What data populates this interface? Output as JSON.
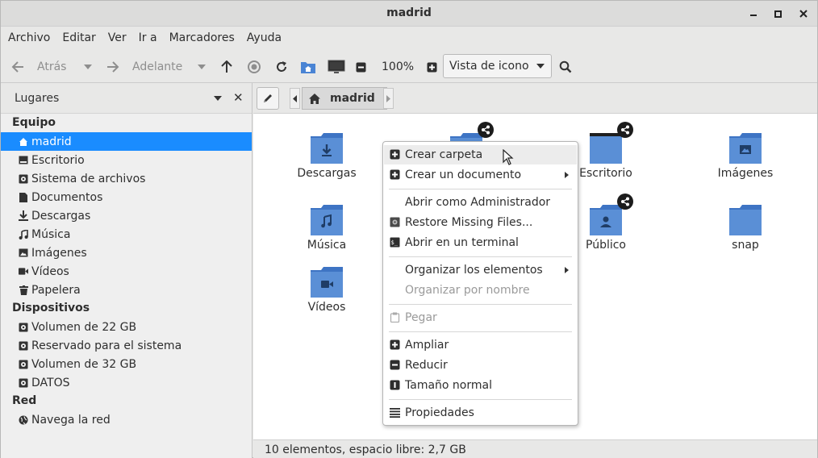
{
  "window": {
    "title": "madrid"
  },
  "menubar": {
    "items": [
      "Archivo",
      "Editar",
      "Ver",
      "Ir a",
      "Marcadores",
      "Ayuda"
    ]
  },
  "toolbar": {
    "back_label": "Atrás",
    "forward_label": "Adelante",
    "zoom": "100%",
    "view_mode": "Vista de icono"
  },
  "sidebar": {
    "header": "Lugares",
    "sections": [
      {
        "title": "Equipo",
        "items": [
          {
            "label": "madrid",
            "icon": "home-icon",
            "active": true
          },
          {
            "label": "Escritorio",
            "icon": "desktop-icon"
          },
          {
            "label": "Sistema de archivos",
            "icon": "drive-icon"
          },
          {
            "label": "Documentos",
            "icon": "document-icon"
          },
          {
            "label": "Descargas",
            "icon": "download-icon"
          },
          {
            "label": "Música",
            "icon": "music-icon"
          },
          {
            "label": "Imágenes",
            "icon": "image-icon"
          },
          {
            "label": "Vídeos",
            "icon": "video-icon"
          },
          {
            "label": "Papelera",
            "icon": "trash-icon"
          }
        ]
      },
      {
        "title": "Dispositivos",
        "items": [
          {
            "label": "Volumen de 22 GB",
            "icon": "drive-icon"
          },
          {
            "label": "Reservado para el sistema",
            "icon": "drive-icon"
          },
          {
            "label": "Volumen de 32 GB",
            "icon": "drive-icon"
          },
          {
            "label": "DATOS",
            "icon": "drive-icon"
          }
        ]
      },
      {
        "title": "Red",
        "items": [
          {
            "label": "Navega la red",
            "icon": "network-icon"
          }
        ]
      }
    ]
  },
  "location": {
    "crumb": "madrid"
  },
  "files": [
    {
      "name": "Descargas",
      "icon": "download-icon"
    },
    {
      "name": "Escritorio",
      "icon": "desktop-icon",
      "shared": true
    },
    {
      "name": "Imágenes",
      "icon": "image-icon"
    },
    {
      "name": "Música",
      "icon": "music-icon"
    },
    {
      "name": "Público",
      "icon": "user-icon",
      "shared": true
    },
    {
      "name": "snap",
      "icon": "folder-icon"
    },
    {
      "name": "Vídeos",
      "icon": "video-icon"
    }
  ],
  "context_menu": {
    "items": {
      "create_folder": "Crear carpeta",
      "create_document": "Crear un documento",
      "open_admin": "Abrir como Administrador",
      "restore": "Restore Missing Files...",
      "open_terminal": "Abrir en un terminal",
      "organize": "Organizar los elementos",
      "organize_name": "Organizar por nombre",
      "paste": "Pegar",
      "zoom_in": "Ampliar",
      "zoom_out": "Reducir",
      "normal_size": "Tamaño normal",
      "properties": "Propiedades"
    }
  },
  "statusbar": {
    "text": "10 elementos, espacio libre: 2,7 GB"
  },
  "colors": {
    "accent": "#1a8cff",
    "folder": "#5a8fd6"
  }
}
